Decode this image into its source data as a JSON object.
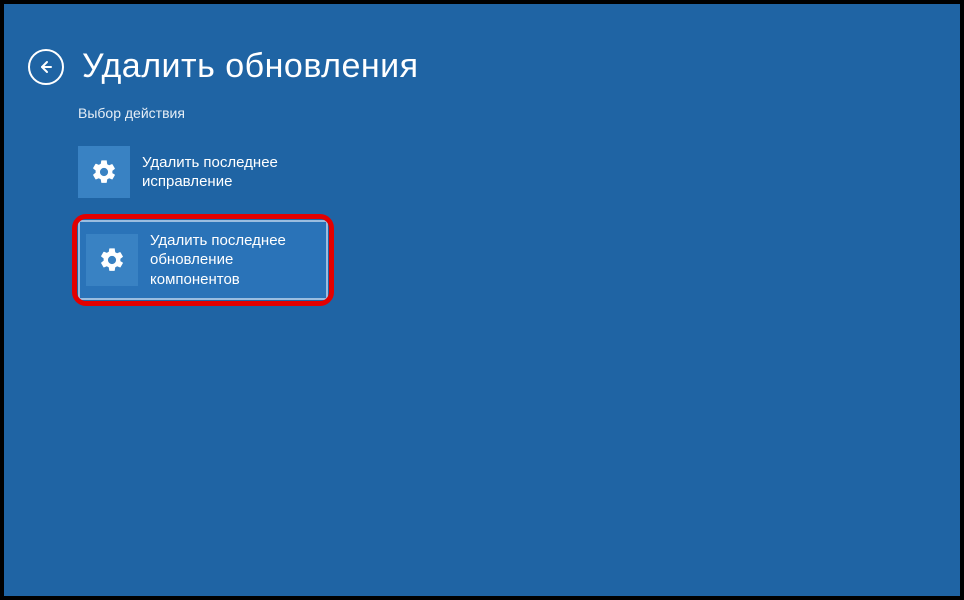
{
  "header": {
    "title": "Удалить обновления",
    "subtitle": "Выбор действия"
  },
  "options": {
    "quality": {
      "label": "Удалить последнее исправление"
    },
    "feature": {
      "label": "Удалить последнее обновление компонентов"
    }
  }
}
